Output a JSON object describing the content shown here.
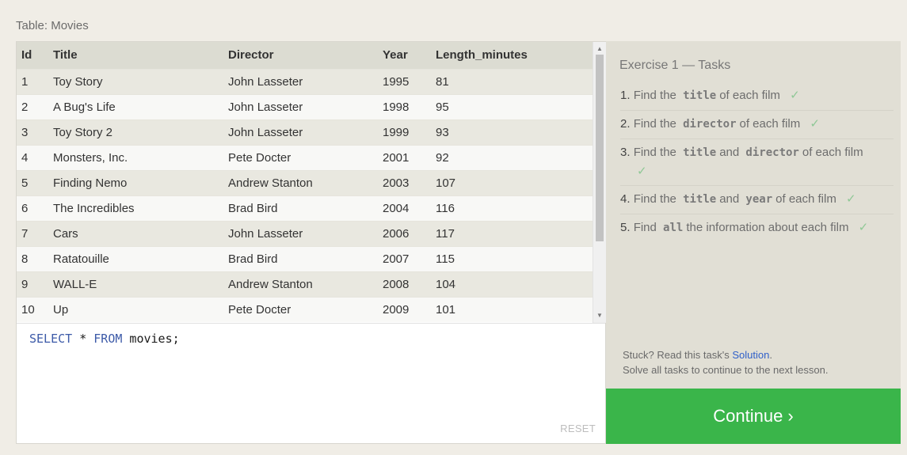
{
  "table_caption": "Table: Movies",
  "table": {
    "columns": [
      "Id",
      "Title",
      "Director",
      "Year",
      "Length_minutes"
    ],
    "rows": [
      [
        "1",
        "Toy Story",
        "John Lasseter",
        "1995",
        "81"
      ],
      [
        "2",
        "A Bug's Life",
        "John Lasseter",
        "1998",
        "95"
      ],
      [
        "3",
        "Toy Story 2",
        "John Lasseter",
        "1999",
        "93"
      ],
      [
        "4",
        "Monsters, Inc.",
        "Pete Docter",
        "2001",
        "92"
      ],
      [
        "5",
        "Finding Nemo",
        "Andrew Stanton",
        "2003",
        "107"
      ],
      [
        "6",
        "The Incredibles",
        "Brad Bird",
        "2004",
        "116"
      ],
      [
        "7",
        "Cars",
        "John Lasseter",
        "2006",
        "117"
      ],
      [
        "8",
        "Ratatouille",
        "Brad Bird",
        "2007",
        "115"
      ],
      [
        "9",
        "WALL-E",
        "Andrew Stanton",
        "2008",
        "104"
      ],
      [
        "10",
        "Up",
        "Pete Docter",
        "2009",
        "101"
      ]
    ]
  },
  "editor": {
    "keyword_select": "SELECT",
    "star": " * ",
    "keyword_from": "FROM",
    "rest": " movies;",
    "reset_label": "RESET"
  },
  "exercise": {
    "title": "Exercise 1 — Tasks",
    "check_mark": "✓",
    "tasks": [
      {
        "num": "1.",
        "pre": "Find the",
        "code": "title",
        "post": "of each film"
      },
      {
        "num": "2.",
        "pre": "Find the",
        "code": "director",
        "post": "of each film"
      },
      {
        "num": "3.",
        "pre": "Find the",
        "code": "title",
        "mid": "and",
        "code2": "director",
        "post": "of each film"
      },
      {
        "num": "4.",
        "pre": "Find the",
        "code": "title",
        "mid": "and",
        "code2": "year",
        "post": "of each film"
      },
      {
        "num": "5.",
        "pre": "Find",
        "code": "all",
        "post": "the information about each film"
      }
    ]
  },
  "help": {
    "stuck_pre": "Stuck? Read this task's ",
    "solution_link": "Solution",
    "stuck_post": ".",
    "line2": "Solve all tasks to continue to the next lesson."
  },
  "continue_label": "Continue ›",
  "colors": {
    "accent_green": "#3ab54a",
    "link_blue": "#3060c9",
    "sql_keyword": "#3c5aa8",
    "check_green": "#8fc896"
  },
  "icons": {
    "scroll_up": "▲",
    "scroll_down": "▼"
  }
}
